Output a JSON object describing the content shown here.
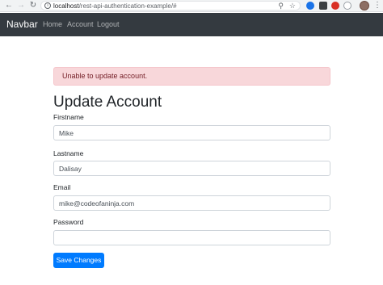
{
  "browser": {
    "url_host": "localhost",
    "url_path": "/rest-api-authentication-example/#",
    "icons": [
      "back-icon",
      "forward-icon",
      "reload-icon",
      "info-icon",
      "zoom-icon",
      "star-icon",
      "extension-icon",
      "menu-icon"
    ]
  },
  "navbar": {
    "brand": "Navbar",
    "links": [
      {
        "label": "Home"
      },
      {
        "label": "Account"
      },
      {
        "label": "Logout"
      }
    ]
  },
  "alert": {
    "message": "Unable to update account.",
    "color": "#f8d7da"
  },
  "page": {
    "title": "Update Account"
  },
  "form": {
    "firstname": {
      "label": "Firstname",
      "value": "Mike"
    },
    "lastname": {
      "label": "Lastname",
      "value": "Dalisay"
    },
    "email": {
      "label": "Email",
      "value": "mike@codeofaninja.com"
    },
    "password": {
      "label": "Password",
      "value": ""
    },
    "submit_label": "Save Changes"
  },
  "colors": {
    "navbar": "#343a40",
    "primary": "#007bff"
  }
}
